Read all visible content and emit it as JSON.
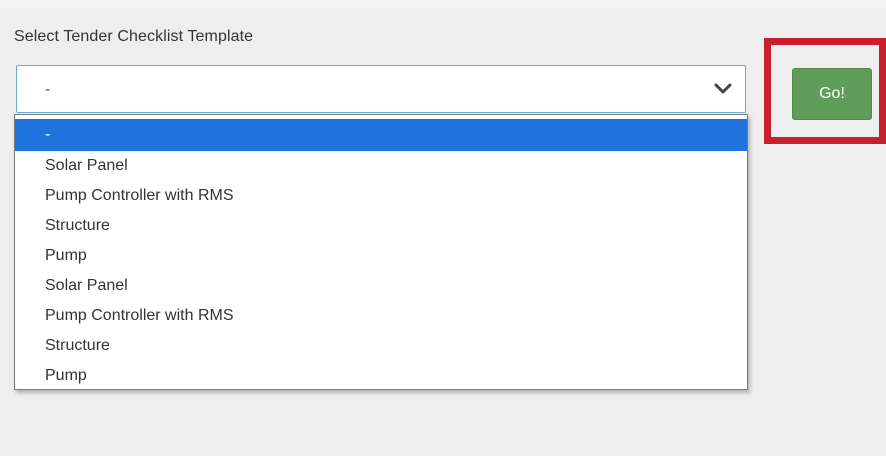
{
  "form": {
    "label": "Select Tender Checklist Template",
    "selected_value": "-",
    "options": [
      "-",
      "Solar Panel",
      "Pump Controller with RMS",
      "Structure",
      "Pump",
      "Solar Panel",
      "Pump Controller with RMS",
      "Structure",
      "Pump"
    ],
    "highlighted_option_index": 0,
    "go_button_label": "Go!"
  },
  "icons": {
    "select_arrow": "chevron-down-icon"
  },
  "colors": {
    "page_background": "#eeeeee",
    "select_border": "#6aa9d6",
    "option_highlight": "#1e74dc",
    "go_button": "#5e9e5a",
    "highlight_frame": "#c8202e"
  }
}
